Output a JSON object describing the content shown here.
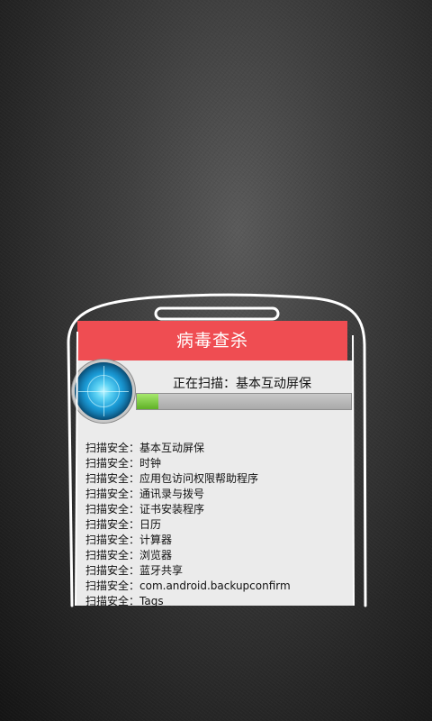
{
  "header": {
    "title": "病毒查杀"
  },
  "scan": {
    "status_text": "正在扫描：基本互动屏保",
    "progress_percent": 10
  },
  "log": {
    "items": [
      "扫描安全：基本互动屏保",
      "扫描安全：时钟",
      "扫描安全：应用包访问权限帮助程序",
      "扫描安全：通讯录与拨号",
      "扫描安全：证书安装程序",
      "扫描安全：日历",
      "扫描安全：计算器",
      "扫描安全：浏览器",
      "扫描安全：蓝牙共享",
      "扫描安全：com.android.backupconfirm",
      "扫描安全：Tags"
    ]
  },
  "colors": {
    "header_red": "#ef4d52",
    "progress_green": "#6cc22f",
    "background_dark": "#2a2a2a"
  },
  "icons": {
    "scanner": "radar-icon"
  }
}
